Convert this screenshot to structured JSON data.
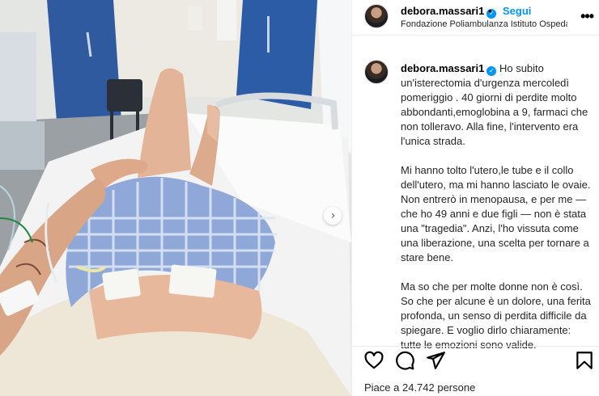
{
  "post": {
    "username": "debora.massari1",
    "location": "Fondazione Poliambulanza Istituto Ospedaliero",
    "follow_label": "Segui",
    "dot": "•",
    "more_label": "•••",
    "verified_glyph": "✓",
    "caption": {
      "p1": "Ho subito un'isterectomia d'urgenza mercoledì pomeriggio . 40 giorni di perdite molto abbondanti,emoglobina a 9, farmaci che non tolleravo. Alla fine, l'intervento era l'unica strada.",
      "p2": "Mi hanno tolto l'utero,le tube e il collo dell'utero, ma mi hanno lasciato le ovaie. Non entrerò in menopausa, e per me — che ho 49 anni e due figli — non è stata una \"tragedia\". Anzi, l'ho vissuta come una liberazione, una scelta per tornare a stare bene.",
      "p3": "Ma so che per molte donne non è così. So che per alcune è un dolore, una ferita profonda, un senso di perdita difficile da spiegare. E voglio dirlo chiaramente: tutte le emozioni sono valide."
    },
    "likes": "Piace a 24.742 persone"
  },
  "icons": {
    "like": "heart-icon",
    "comment": "comment-icon",
    "share": "paper-plane-icon",
    "save": "bookmark-icon",
    "next": "chevron-right-icon",
    "next_glyph": "›"
  },
  "colors": {
    "accent": "#0095f6",
    "text": "#262626",
    "divider": "#efefef"
  }
}
